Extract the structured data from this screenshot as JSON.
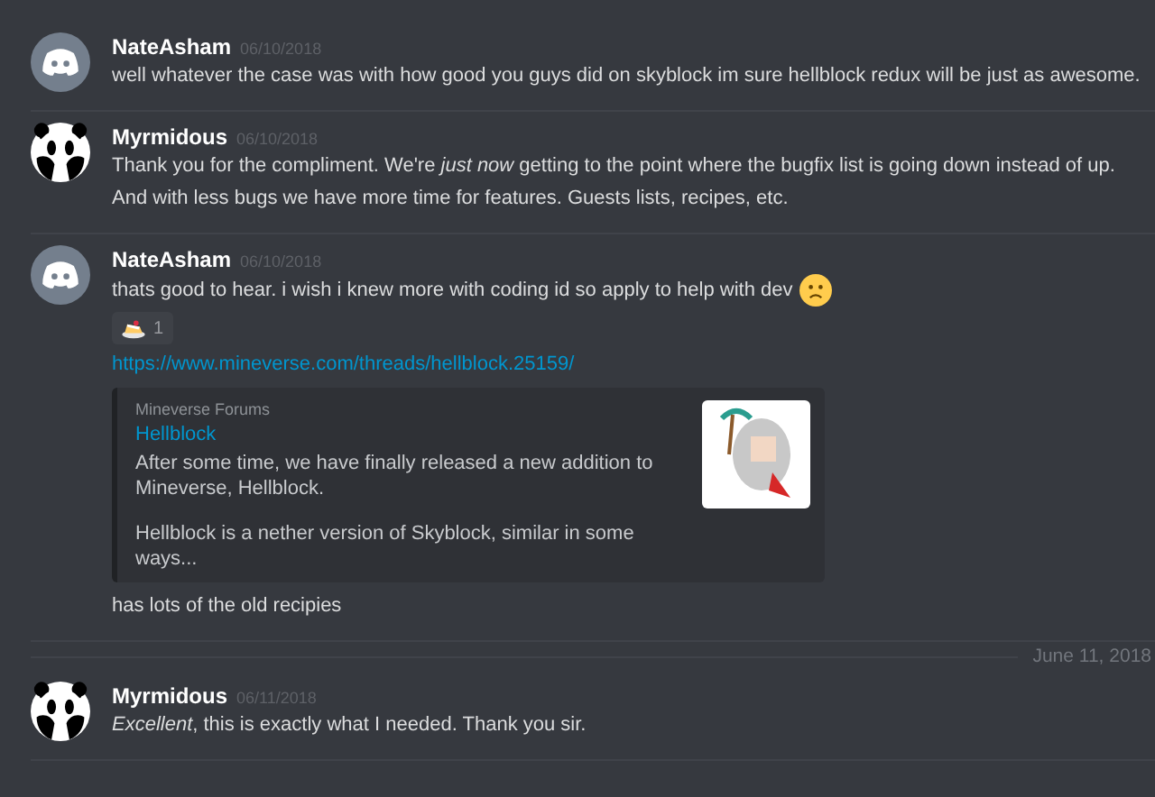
{
  "messages": [
    {
      "author": "NateAsham",
      "avatar": {
        "kind": "discord"
      },
      "timestamp": "06/10/2018",
      "content": [
        {
          "kind": "text",
          "text": "well whatever the case was with how good you guys did on skyblock im sure hellblock redux will be just as awesome."
        }
      ]
    },
    {
      "author": "Myrmidous",
      "avatar": {
        "kind": "panda"
      },
      "timestamp": "06/10/2018",
      "content": [
        {
          "kind": "text",
          "text": "Thank you for the compliment. We're *just now* getting to the point where the bugfix list is going down instead of up."
        },
        {
          "kind": "text",
          "text": "And with less bugs we have more time for features. Guests lists, recipes, etc."
        }
      ]
    },
    {
      "author": "NateAsham",
      "avatar": {
        "kind": "discord"
      },
      "timestamp": "06/10/2018",
      "content": [
        {
          "kind": "text",
          "text": "thats good to hear. i wish i knew more with coding id so apply to help  with dev",
          "emoji": {
            "kind": "sad"
          }
        },
        {
          "kind": "reaction",
          "count": "1"
        },
        {
          "kind": "link",
          "text": "https://www.mineverse.com/threads/hellblock.25159/"
        },
        {
          "kind": "embed",
          "provider": "Mineverse Forums",
          "title": "Hellblock",
          "paragraphs": [
            "After some time, we have finally released a new addition to Mineverse, Hellblock.",
            "Hellblock is a nether version of Skyblock, similar in some ways..."
          ]
        },
        {
          "kind": "text",
          "text": "has lots of the old recipies"
        }
      ]
    },
    {
      "kind": "divider",
      "label": "June 11, 2018"
    },
    {
      "author": "Myrmidous",
      "avatar": {
        "kind": "panda"
      },
      "timestamp": "06/11/2018",
      "content": [
        {
          "kind": "text",
          "text": "*Excellent*, this is exactly what I needed. Thank you sir."
        }
      ]
    }
  ]
}
